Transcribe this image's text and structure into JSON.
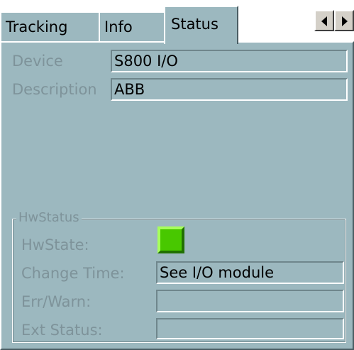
{
  "tabs": [
    {
      "label": "Tracking"
    },
    {
      "label": "Info"
    },
    {
      "label": "Status"
    }
  ],
  "device": {
    "label": "Device",
    "value": "S800 I/O"
  },
  "description": {
    "label": "Description",
    "value": "ABB"
  },
  "hwstatus": {
    "group_label": "HwStatus",
    "hwstate_label": "HwState:",
    "hwstate_color": "#48c800",
    "change_time_label": "Change Time:",
    "change_time_value": "See I/O module",
    "err_warn_label": "Err/Warn:",
    "err_warn_value": "",
    "ext_status_label": "Ext Status:",
    "ext_status_value": ""
  },
  "colors": {
    "panel_bg": "#9cb8bf",
    "disabled_text": "#7e939a"
  }
}
